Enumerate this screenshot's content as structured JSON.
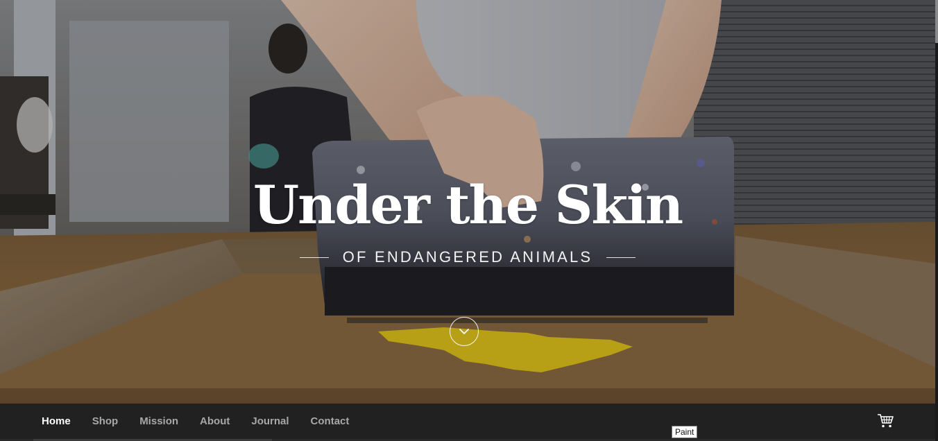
{
  "hero": {
    "title": "Under the Skin",
    "subtitle": "OF ENDANGERED ANIMALS",
    "scroll_icon": "chevron-down-icon"
  },
  "nav": {
    "items": [
      {
        "label": "Home",
        "active": true
      },
      {
        "label": "Shop",
        "active": false
      },
      {
        "label": "Mission",
        "active": false
      },
      {
        "label": "About",
        "active": false
      },
      {
        "label": "Journal",
        "active": false
      },
      {
        "label": "Contact",
        "active": false
      }
    ],
    "cart_icon": "cart-icon"
  },
  "tooltip": {
    "text": "Paint"
  },
  "colors": {
    "nav_background": "#212121",
    "nav_active": "#ffffff",
    "nav_inactive": "#a8a8a8",
    "paint_yellow": "#e0c21c"
  }
}
